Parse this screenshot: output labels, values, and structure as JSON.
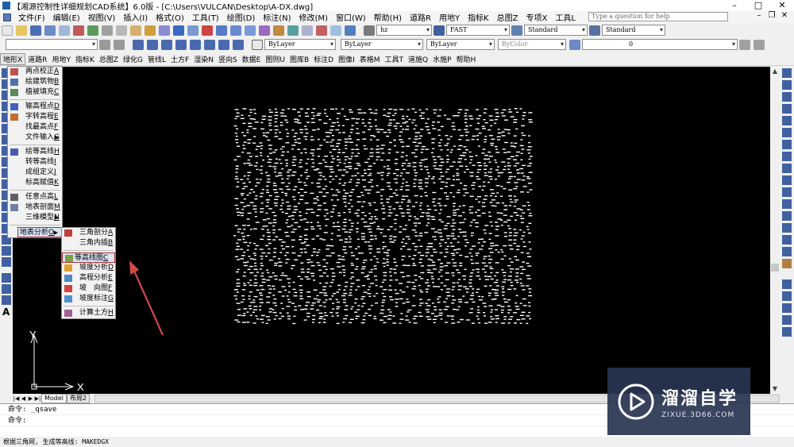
{
  "window": {
    "title": "【湘源控制性详细规划CAD系统】6.0版 - [C:\\Users\\VULCAN\\Desktop\\A-DX.dwg]",
    "controls": [
      "–",
      "□",
      "✕"
    ]
  },
  "menubar": {
    "items": [
      "文件(F)",
      "编辑(E)",
      "视图(V)",
      "插入(I)",
      "格式(O)",
      "工具(T)",
      "绘图(D)",
      "标注(N)",
      "修改(M)",
      "窗口(W)",
      "帮助(H)",
      "道路R",
      "用地Y",
      "指标K",
      "总图Z",
      "专项X",
      "工具L"
    ],
    "help_placeholder": "Type a question for help",
    "mdi_controls": [
      "–",
      "❐",
      "✕"
    ]
  },
  "toolbar2": {
    "text_style": "hz",
    "dim_style": "FAST",
    "table_style": "Standard",
    "multileader_style": "Standard"
  },
  "toolbar3": {
    "layer_control": "ByLayer",
    "linetype_control": "ByLayer",
    "lineweight_control": "ByLayer",
    "plot_style": "ByColor",
    "layer_name": "0"
  },
  "custom_menu": {
    "items": [
      "地形X",
      "道路R",
      "用地Y",
      "指标K",
      "总图Z",
      "绿化G",
      "管线L",
      "土方F",
      "湿染N",
      "竖向S",
      "数据E",
      "图则U",
      "图库B",
      "标注D",
      "图像I",
      "表格M",
      "工具T",
      "道施Q",
      "水施P",
      "帮助H"
    ],
    "active_index": 0
  },
  "terrain_menu": {
    "items": [
      {
        "label": "两点校正",
        "key": "A",
        "icon": "calibrate-icon"
      },
      {
        "label": "绘建筑物",
        "key": "B",
        "icon": "building-icon"
      },
      {
        "label": "植被填充",
        "key": "C",
        "icon": "vegetation-icon"
      },
      {
        "sep": true
      },
      {
        "label": "输高程点",
        "key": "D",
        "icon": "elevation-point-icon"
      },
      {
        "label": "字转高程",
        "key": "E",
        "icon": "text-elevation-icon"
      },
      {
        "label": "找最高点",
        "key": "F",
        "icon": "peak-icon"
      },
      {
        "label": "文件输入",
        "key": "G",
        "icon": "",
        "submenu": true
      },
      {
        "sep": true
      },
      {
        "label": "绘等高线",
        "key": "H",
        "icon": "contour-draw-icon"
      },
      {
        "label": "转等高线",
        "key": "I",
        "icon": ""
      },
      {
        "label": "成组定义",
        "key": "J",
        "icon": ""
      },
      {
        "label": "标高赋值",
        "key": "K",
        "icon": ""
      },
      {
        "sep": true
      },
      {
        "label": "任意点高",
        "key": "L",
        "icon": "any-height-icon"
      },
      {
        "label": "地表剖面",
        "key": "M",
        "icon": "profile-icon"
      },
      {
        "label": "三维模型",
        "key": "N",
        "icon": "",
        "submenu": true
      },
      {
        "sep": true
      },
      {
        "label": "地表分析",
        "key": "O",
        "icon": "",
        "submenu": true,
        "highlight": true
      }
    ]
  },
  "analysis_submenu": {
    "items": [
      {
        "label": "三角剖分",
        "key": "A",
        "icon": "triangulate-icon"
      },
      {
        "label": "三角内插",
        "key": "B",
        "icon": ""
      },
      {
        "sep": true
      },
      {
        "label": "等高线图",
        "key": "C",
        "icon": "contour-map-icon",
        "highlight": true
      },
      {
        "label": "坡度分析",
        "key": "D",
        "icon": "slope-icon"
      },
      {
        "label": "高程分析",
        "key": "E",
        "icon": "elevation-analysis-icon"
      },
      {
        "label": "坡　向图",
        "key": "F",
        "icon": "aspect-icon"
      },
      {
        "label": "坡度标注",
        "key": "G",
        "icon": "slope-label-icon"
      },
      {
        "sep": true
      },
      {
        "label": "计算土方",
        "key": "H",
        "icon": "earthwork-icon"
      }
    ]
  },
  "ucs": {
    "y": "Y",
    "x": "X"
  },
  "tabs": {
    "nav": [
      "|◀",
      "◀",
      "▶",
      "▶|"
    ],
    "model": "Model",
    "layout": "布局2"
  },
  "command": {
    "lines": [
      "命令:  _qsave",
      "命令:"
    ],
    "status": "根据三角网, 生成等高线: MAKEDGX"
  },
  "watermark": {
    "name": "溜溜自学",
    "url": "ZIXUE.3D66.COM"
  },
  "colors": {
    "canvas": "#000000",
    "highlight_border": "#b03030",
    "arrow": "#d04a4a"
  }
}
